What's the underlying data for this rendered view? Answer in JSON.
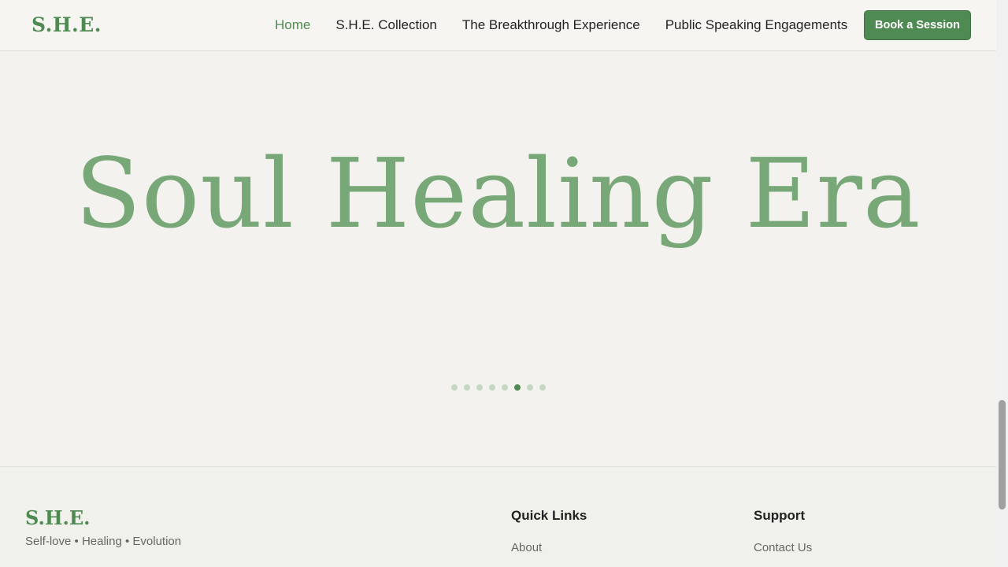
{
  "header": {
    "logo": "S.H.E.",
    "nav": [
      {
        "label": "Home",
        "active": true
      },
      {
        "label": "S.H.E. Collection",
        "active": false
      },
      {
        "label": "The Breakthrough Experience",
        "active": false
      },
      {
        "label": "Public Speaking Engagements",
        "active": false
      }
    ],
    "cta_label": "Book a Session"
  },
  "hero": {
    "title": "Soul Healing Era",
    "slide_count": 8,
    "active_slide": 6
  },
  "footer": {
    "logo": "S.H.E.",
    "tagline": "Self-love • Healing • Evolution",
    "quick_links": {
      "heading": "Quick Links",
      "items": [
        "About"
      ]
    },
    "support": {
      "heading": "Support",
      "items": [
        "Contact Us"
      ]
    }
  },
  "colors": {
    "brand_green": "#4f8a52",
    "hero_title_green": "#78a878",
    "background": "#f3f2ee",
    "dot_inactive": "#c6d8c4"
  }
}
